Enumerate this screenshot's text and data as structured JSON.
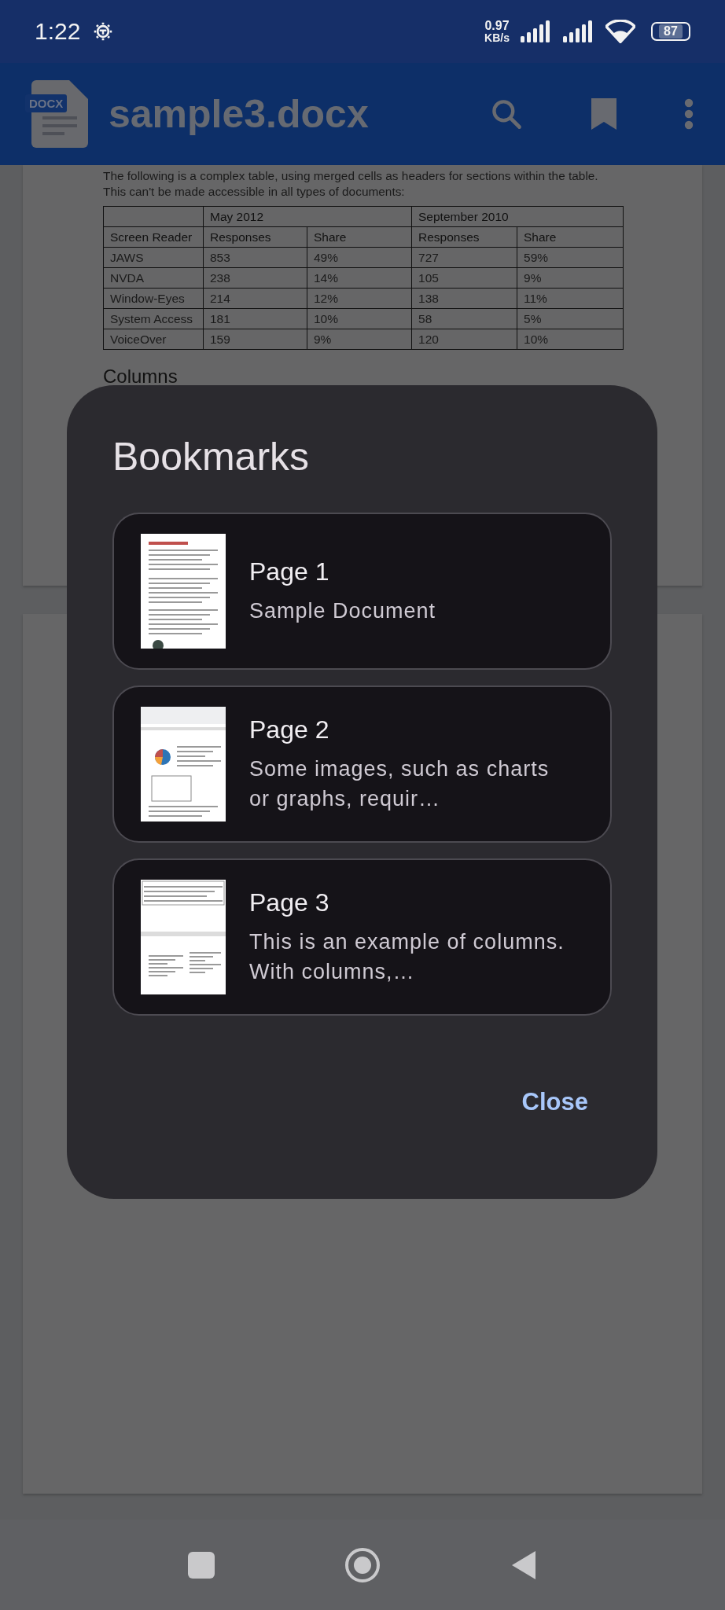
{
  "status_bar": {
    "time": "1:22",
    "net_speed": "0.97",
    "net_unit": "KB/s",
    "battery": "87"
  },
  "app_bar": {
    "file_badge": "DOCX",
    "title": "sample3.docx"
  },
  "document": {
    "intro": "The following is a complex table, using merged cells as headers for sections within the table. This can't be made accessible in all types of documents:",
    "table": {
      "groups": [
        {
          "label": "May 2012"
        },
        {
          "label": "September 2010"
        }
      ],
      "columns": [
        "Screen Reader",
        "Responses",
        "Share",
        "Responses",
        "Share"
      ],
      "rows": [
        [
          "JAWS",
          "853",
          "49%",
          "727",
          "59%"
        ],
        [
          "NVDA",
          "238",
          "14%",
          "105",
          "9%"
        ],
        [
          "Window-Eyes",
          "214",
          "12%",
          "138",
          "11%"
        ],
        [
          "System Access",
          "181",
          "10%",
          "58",
          "5%"
        ],
        [
          "VoiceOver",
          "159",
          "9%",
          "120",
          "10%"
        ]
      ]
    },
    "next_heading": "Columns"
  },
  "dialog": {
    "title": "Bookmarks",
    "bookmarks": [
      {
        "title": "Page 1",
        "snippet": "Sample Document",
        "kind": "text"
      },
      {
        "title": "Page 2",
        "snippet": "Some images, such as charts or graphs, requir…",
        "kind": "chart"
      },
      {
        "title": "Page 3",
        "snippet": "This is an example of columns. With columns,…",
        "kind": "columns"
      }
    ],
    "close": "Close"
  }
}
